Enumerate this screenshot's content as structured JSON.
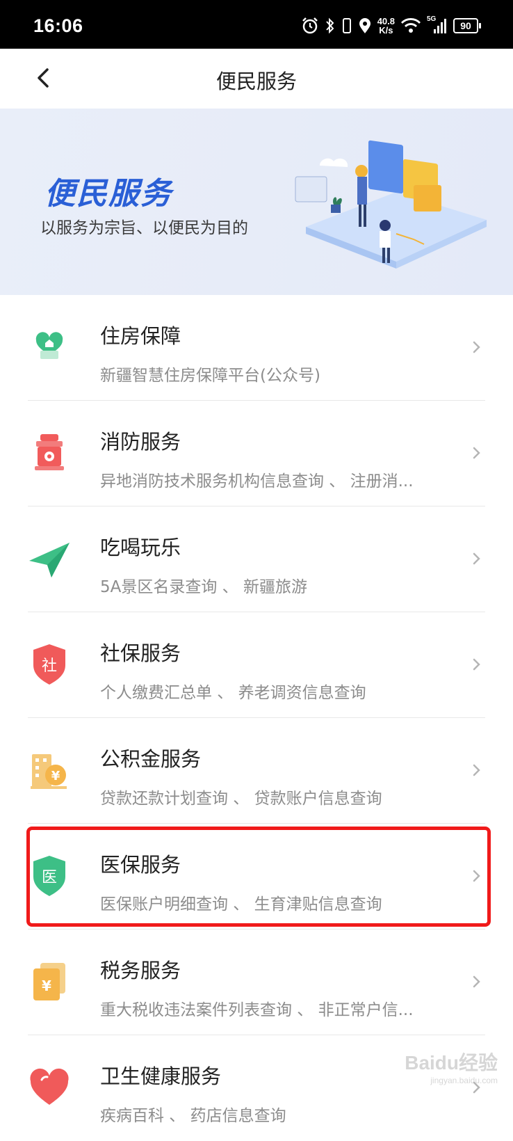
{
  "status_bar": {
    "time": "16:06",
    "net_speed_value": "40.8",
    "net_speed_unit": "K/s",
    "signal_label": "5G",
    "battery": "90"
  },
  "header": {
    "title": "便民服务"
  },
  "banner": {
    "title": "便民服务",
    "subtitle": "以服务为宗旨、以便民为目的"
  },
  "services": [
    {
      "name": "住房保障",
      "desc": "新疆智慧住房保障平台(公众号)",
      "icon": "house-heart-icon",
      "color": "#3dbf86"
    },
    {
      "name": "消防服务",
      "desc": "异地消防技术服务机构信息查询 、 注册消...",
      "icon": "fire-hydrant-icon",
      "color": "#f15b5b"
    },
    {
      "name": "吃喝玩乐",
      "desc": "5A景区名录查询 、 新疆旅游",
      "icon": "paper-plane-icon",
      "color": "#3dbf86"
    },
    {
      "name": "社保服务",
      "desc": "个人缴费汇总单 、 养老调资信息查询",
      "icon": "shield-social-icon",
      "color": "#f05a5a",
      "glyph": "社"
    },
    {
      "name": "公积金服务",
      "desc": "贷款还款计划查询 、 贷款账户信息查询",
      "icon": "building-yen-icon",
      "color": "#f5b54a",
      "glyph": "¥"
    },
    {
      "name": "医保服务",
      "desc": "医保账户明细查询 、 生育津贴信息查询",
      "icon": "shield-medical-icon",
      "color": "#3dbf86",
      "glyph": "医"
    },
    {
      "name": "税务服务",
      "desc": "重大税收违法案件列表查询 、 非正常户信...",
      "icon": "tax-document-icon",
      "color": "#f5b54a",
      "glyph": "¥"
    },
    {
      "name": "卫生健康服务",
      "desc": "疾病百科 、 药店信息查询",
      "icon": "heart-icon",
      "color": "#f05a5a"
    }
  ],
  "watermark": {
    "brand": "Baidu经验",
    "domain": "jingyan.baidu.com"
  },
  "colors": {
    "highlight_border": "#f01a1a",
    "banner_title": "#2a5fd6"
  }
}
